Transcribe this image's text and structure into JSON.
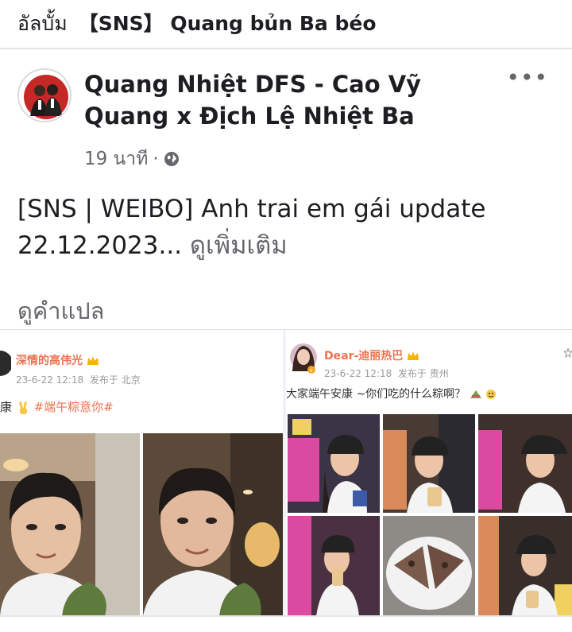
{
  "topbar": {
    "crumb": "อัลบั้ม",
    "title": "【SNS】 Quang bủn Ba béo"
  },
  "post": {
    "author": "Quang Nhiệt DFS - Cao Vỹ Quang x Địch Lệ Nhiệt Ba",
    "time": "19 นาที",
    "separator": "·",
    "privacy_icon": "globe-icon",
    "more_icon": "more-options-icon",
    "more_glyph": "•••",
    "text": "[SNS | WEIBO] Anh trai em gái update 22.12.2023...",
    "see_more": "ดูเพิ่มเติม",
    "translate": "ดูคำแปล"
  },
  "weibo_left": {
    "name": "深情的高伟光",
    "time": "23-6-22 12:18",
    "source": "发布于 北京",
    "text_prefix": "康",
    "hashtag": "#端午粽意你#"
  },
  "weibo_right": {
    "name": "Dear-迪丽热巴",
    "time": "23-6-22 12:18",
    "source": "发布于 贵州",
    "text": "大家端午安康 ~你们吃的什么粽啊？"
  },
  "colors": {
    "accent": "#1877f2",
    "weibo_orange": "#eb7350",
    "muted": "#65676b"
  }
}
